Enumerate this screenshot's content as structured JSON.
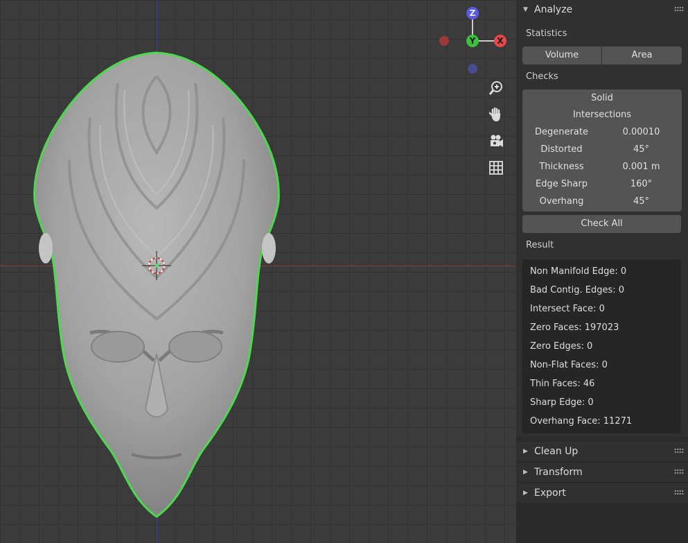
{
  "viewport": {
    "gizmo": {
      "z_label": "Z",
      "y_label": "Y",
      "x_label": "X"
    },
    "nav_icons": [
      "zoom-icon",
      "hand-icon",
      "camera-icon",
      "grid-icon"
    ]
  },
  "colors": {
    "outline": "#4dd94d",
    "gizmo_x": "#e84848",
    "gizmo_y": "#3ac23a",
    "gizmo_z": "#5a5ae0"
  },
  "sidebar": {
    "analyze": {
      "title": "Analyze",
      "statistics_label": "Statistics",
      "volume_btn": "Volume",
      "area_btn": "Area",
      "checks_label": "Checks",
      "solid_label": "Solid",
      "intersections_label": "Intersections",
      "checks": [
        {
          "label": "Degenerate",
          "value": "0.00010"
        },
        {
          "label": "Distorted",
          "value": "45°"
        },
        {
          "label": "Thickness",
          "value": "0.001 m"
        },
        {
          "label": "Edge Sharp",
          "value": "160°"
        },
        {
          "label": "Overhang",
          "value": "45°"
        }
      ],
      "check_all_btn": "Check All",
      "result_label": "Result",
      "results": [
        "Non Manifold Edge: 0",
        "Bad Contig. Edges: 0",
        "Intersect Face: 0",
        "Zero Faces: 197023",
        "Zero Edges: 0",
        "Non-Flat Faces: 0",
        "Thin Faces: 46",
        "Sharp Edge: 0",
        "Overhang Face: 11271"
      ]
    },
    "collapsed_panels": [
      "Clean Up",
      "Transform",
      "Export"
    ]
  }
}
